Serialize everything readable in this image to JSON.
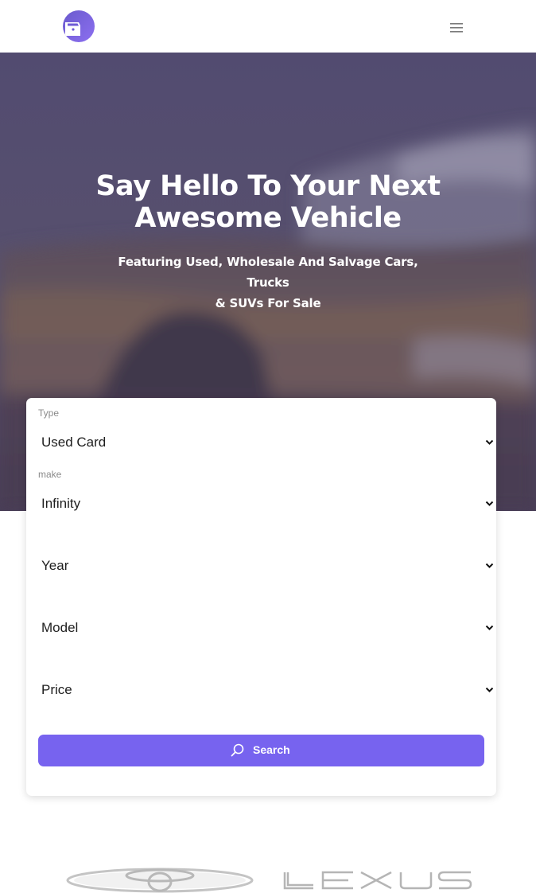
{
  "header": {
    "logo_icon": "car-icon",
    "menu_icon": "hamburger-menu-icon"
  },
  "hero": {
    "title_line1": "Say Hello To Your Next",
    "title_line2": "Awesome Vehicle",
    "subtitle_line1": "Featuring Used, Wholesale And Salvage Cars, Trucks",
    "subtitle_line2": "& SUVs For Sale"
  },
  "search": {
    "type_label": "Type",
    "type_value": "Used Card",
    "make_label": "make",
    "make_value": "Infinity",
    "year_value": "Year",
    "model_value": "Model",
    "price_value": "Price",
    "button_label": "Search"
  },
  "brands": [
    "toyota-logo",
    "lexus-logo"
  ],
  "colors": {
    "accent": "#7763ef",
    "hero_overlay": "#4a4566",
    "text_dark": "#1e1e1e",
    "label_gray": "#8a8a8a"
  }
}
